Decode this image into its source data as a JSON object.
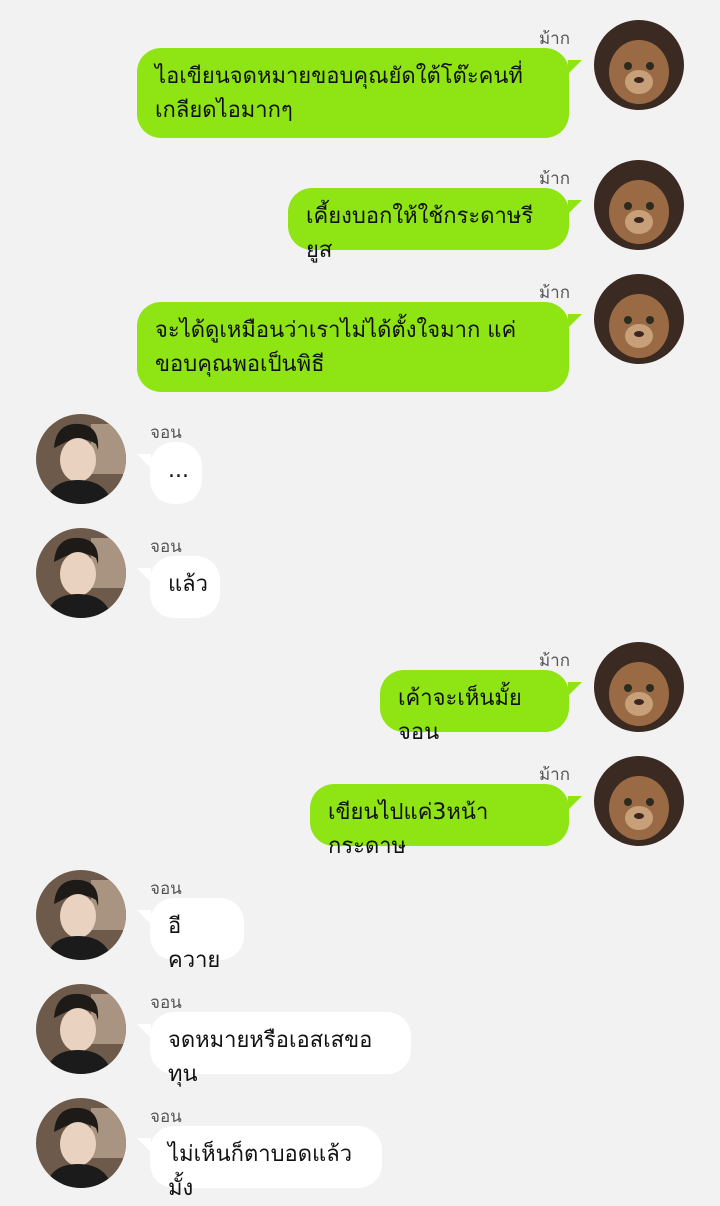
{
  "colors": {
    "background": "#f2f2f2",
    "outgoing_bubble": "#8fe414",
    "incoming_bubble": "#ffffff"
  },
  "avatars": {
    "right_user_icon": "lion-cub-avatar",
    "left_user_icon": "person-avatar"
  },
  "messages": [
    {
      "side": "right",
      "sender": "ม้าก",
      "text": "ไอเขียนจดหมายขอบคุณยัดใต้โต๊ะคนที่\nเกลียดไอมากๆ"
    },
    {
      "side": "right",
      "sender": "ม้าก",
      "text": "เคี้ยงบอกให้ใช้กระดาษรียูส"
    },
    {
      "side": "right",
      "sender": "ม้าก",
      "text": "จะได้ดูเหมือนว่าเราไม่ได้ตั้งใจมาก แค่\nขอบคุณพอเป็นพิธี"
    },
    {
      "side": "left",
      "sender": "จอน",
      "text": "..."
    },
    {
      "side": "left",
      "sender": "จอน",
      "text": "แล้ว"
    },
    {
      "side": "right",
      "sender": "ม้าก",
      "text": "เค้าจะเห็นมั้ยจอน"
    },
    {
      "side": "right",
      "sender": "ม้าก",
      "text": "เขียนไปแค่3หน้ากระดาษ"
    },
    {
      "side": "left",
      "sender": "จอน",
      "text": "อีควาย"
    },
    {
      "side": "left",
      "sender": "จอน",
      "text": "จดหมายหรือเอสเสขอทุน"
    },
    {
      "side": "left",
      "sender": "จอน",
      "text": "ไม่เห็นก็ตาบอดแล้วมั้ง"
    }
  ]
}
